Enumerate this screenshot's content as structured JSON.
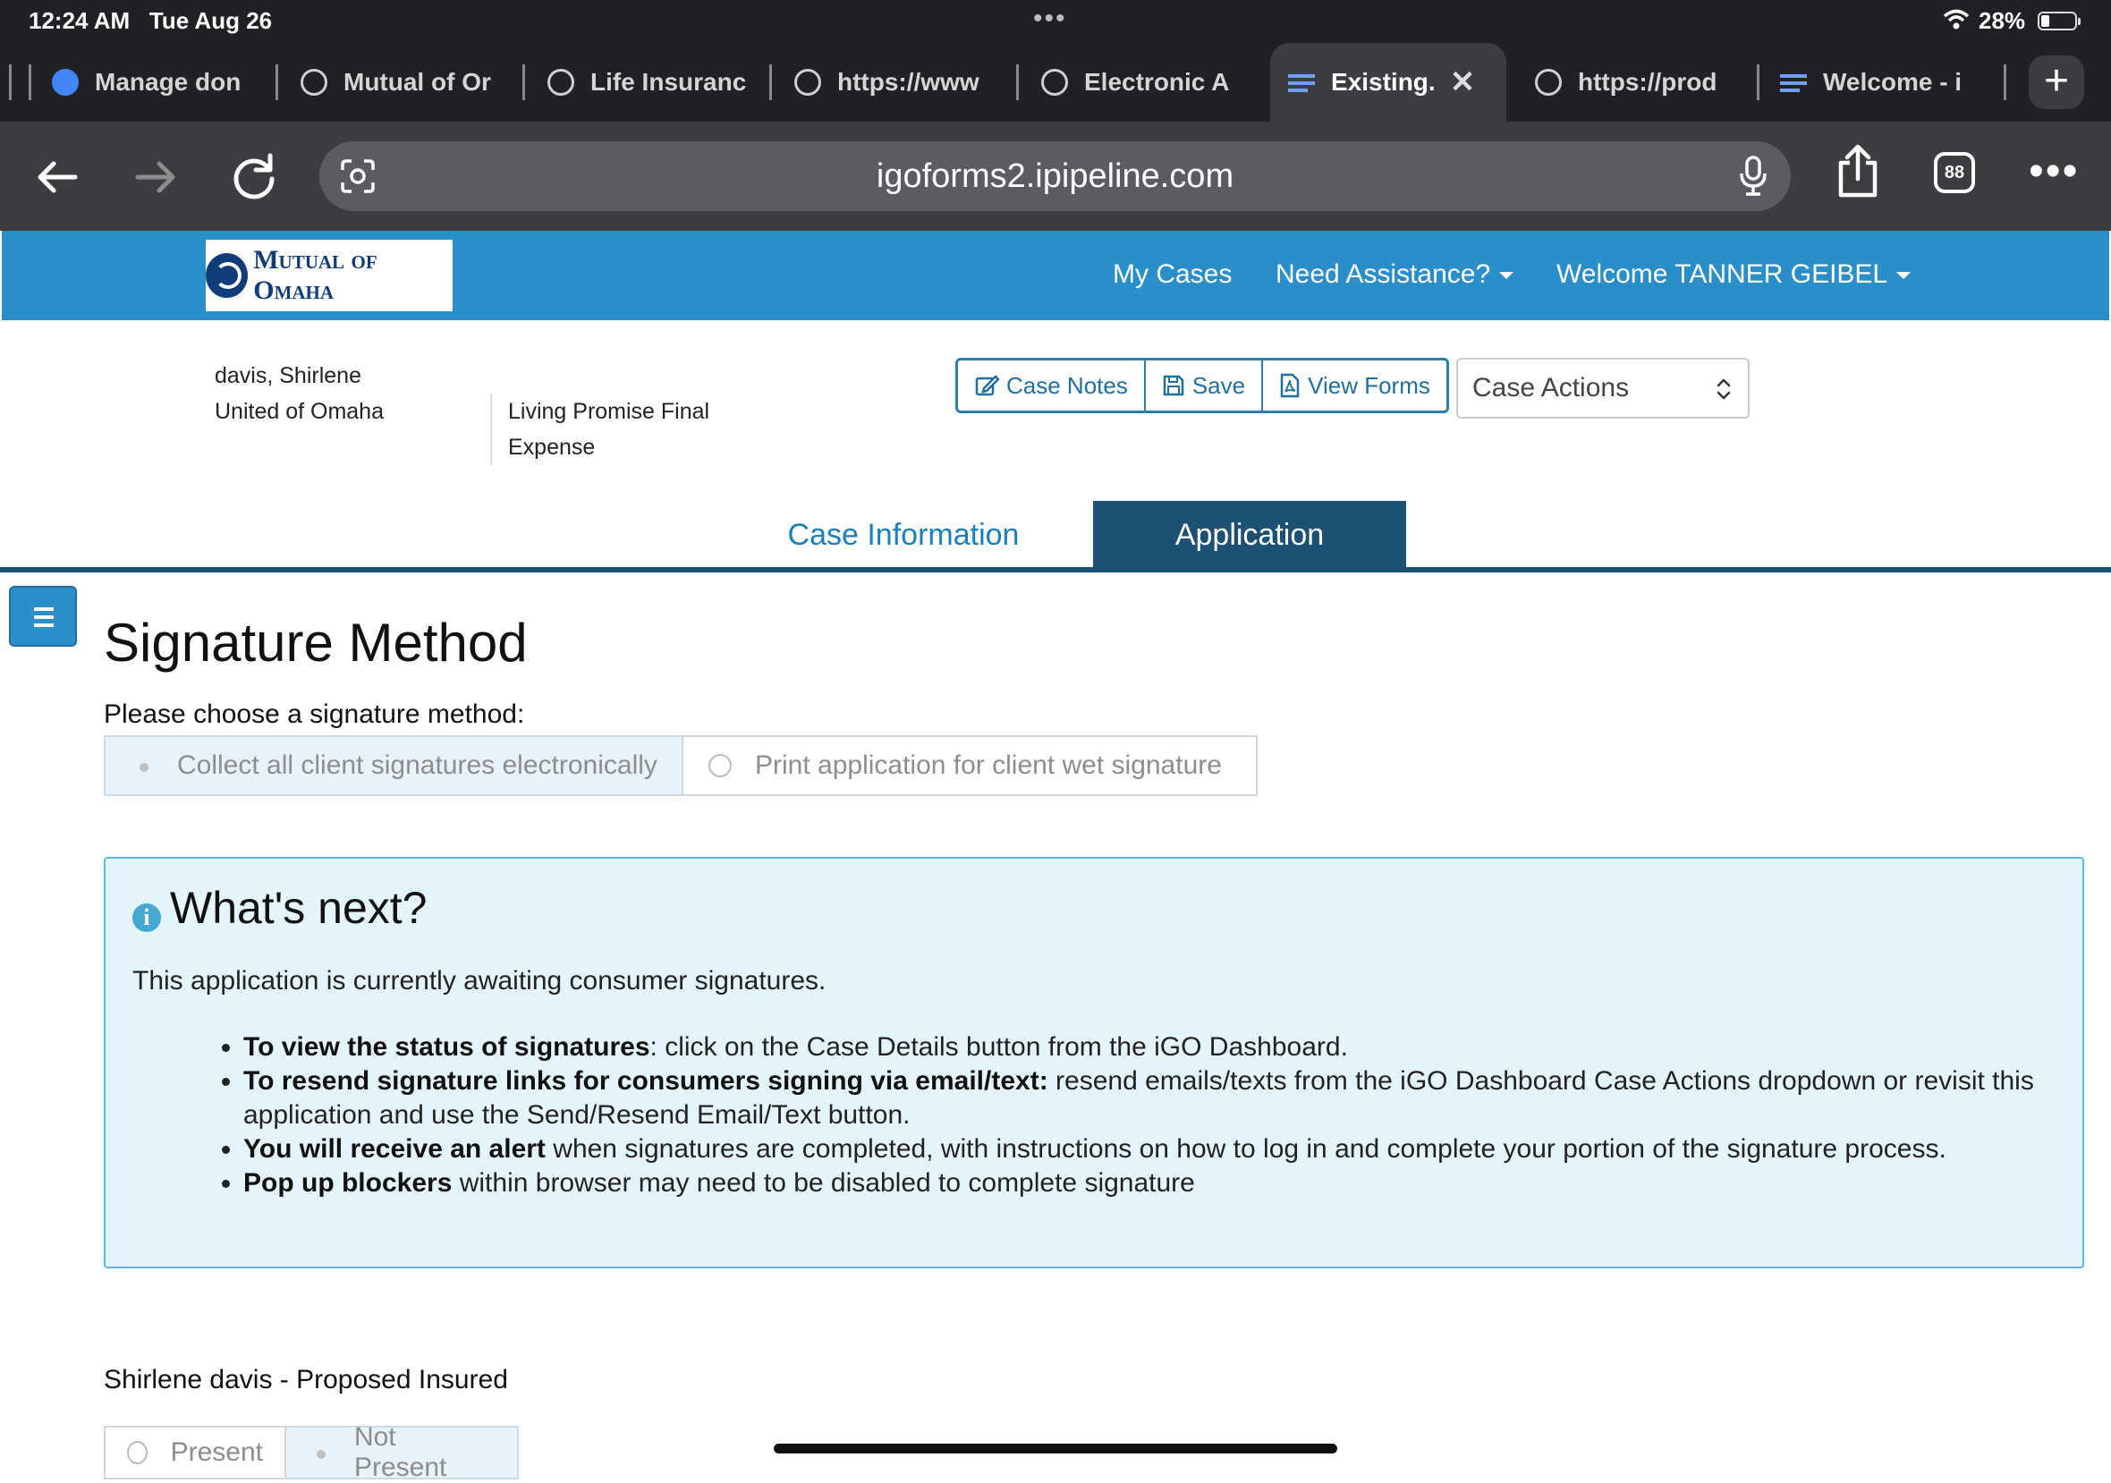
{
  "status_bar": {
    "time": "12:24 AM",
    "date": "Tue Aug 26",
    "battery_percent": "28%",
    "battery_level": 0.28
  },
  "tabs": [
    {
      "label": "Manage don",
      "icon": "google-admin-icon"
    },
    {
      "label": "Mutual of Or",
      "icon": "globe-icon"
    },
    {
      "label": "Life Insuranc",
      "icon": "mutual-omaha-icon"
    },
    {
      "label": "https://www",
      "icon": "globe-icon"
    },
    {
      "label": "Electronic A",
      "icon": "mutual-omaha-icon"
    },
    {
      "label": "Existing.",
      "icon": "menu-lines-icon",
      "active": true
    },
    {
      "label": "https://prod",
      "icon": "globe-icon"
    },
    {
      "label": "Welcome - i",
      "icon": "menu-lines-icon"
    }
  ],
  "toolbar": {
    "url": "igoforms2.ipipeline.com",
    "tab_count": "88"
  },
  "header": {
    "logo_text": "Mutual of Omaha",
    "nav": {
      "my_cases": "My Cases",
      "need_assistance": "Need Assistance?",
      "welcome_prefix": "Welcome",
      "user_name": "TANNER GEIBEL"
    }
  },
  "case": {
    "client_name": "davis, Shirlene",
    "company": "United of Omaha",
    "product_line1": "Living Promise Final",
    "product_line2": "Expense",
    "buttons": {
      "case_notes": "Case Notes",
      "save": "Save",
      "view_forms": "View Forms"
    },
    "case_actions": "Case Actions"
  },
  "main_tabs": {
    "case_information": "Case Information",
    "application": "Application"
  },
  "content": {
    "title": "Signature Method",
    "choose_label": "Please choose a signature method:",
    "options": {
      "electronic": "Collect all client signatures electronically",
      "wet": "Print application for client wet signature"
    },
    "selected_option": "electronic",
    "info": {
      "title": "What's next?",
      "description": "This application is currently awaiting consumer signatures.",
      "bullets": [
        {
          "bold": "To view the status of signatures",
          "text": ": click on the Case Details button from the iGO Dashboard."
        },
        {
          "bold": "To resend signature links for consumers signing via email/text:",
          "text": " resend emails/texts from the iGO Dashboard Case Actions dropdown or revisit this application and use the Send/Resend Email/Text button."
        },
        {
          "bold": "You will receive an alert",
          "text": " when signatures are completed, with instructions on how to log in and complete your portion of the signature process."
        },
        {
          "bold": "Pop up blockers",
          "text": " within browser may need to be disabled to complete signature"
        }
      ]
    },
    "insured": {
      "title": "Shirlene davis - Proposed Insured",
      "present": "Present",
      "not_present": "Not Present",
      "selected": "not_present"
    }
  }
}
